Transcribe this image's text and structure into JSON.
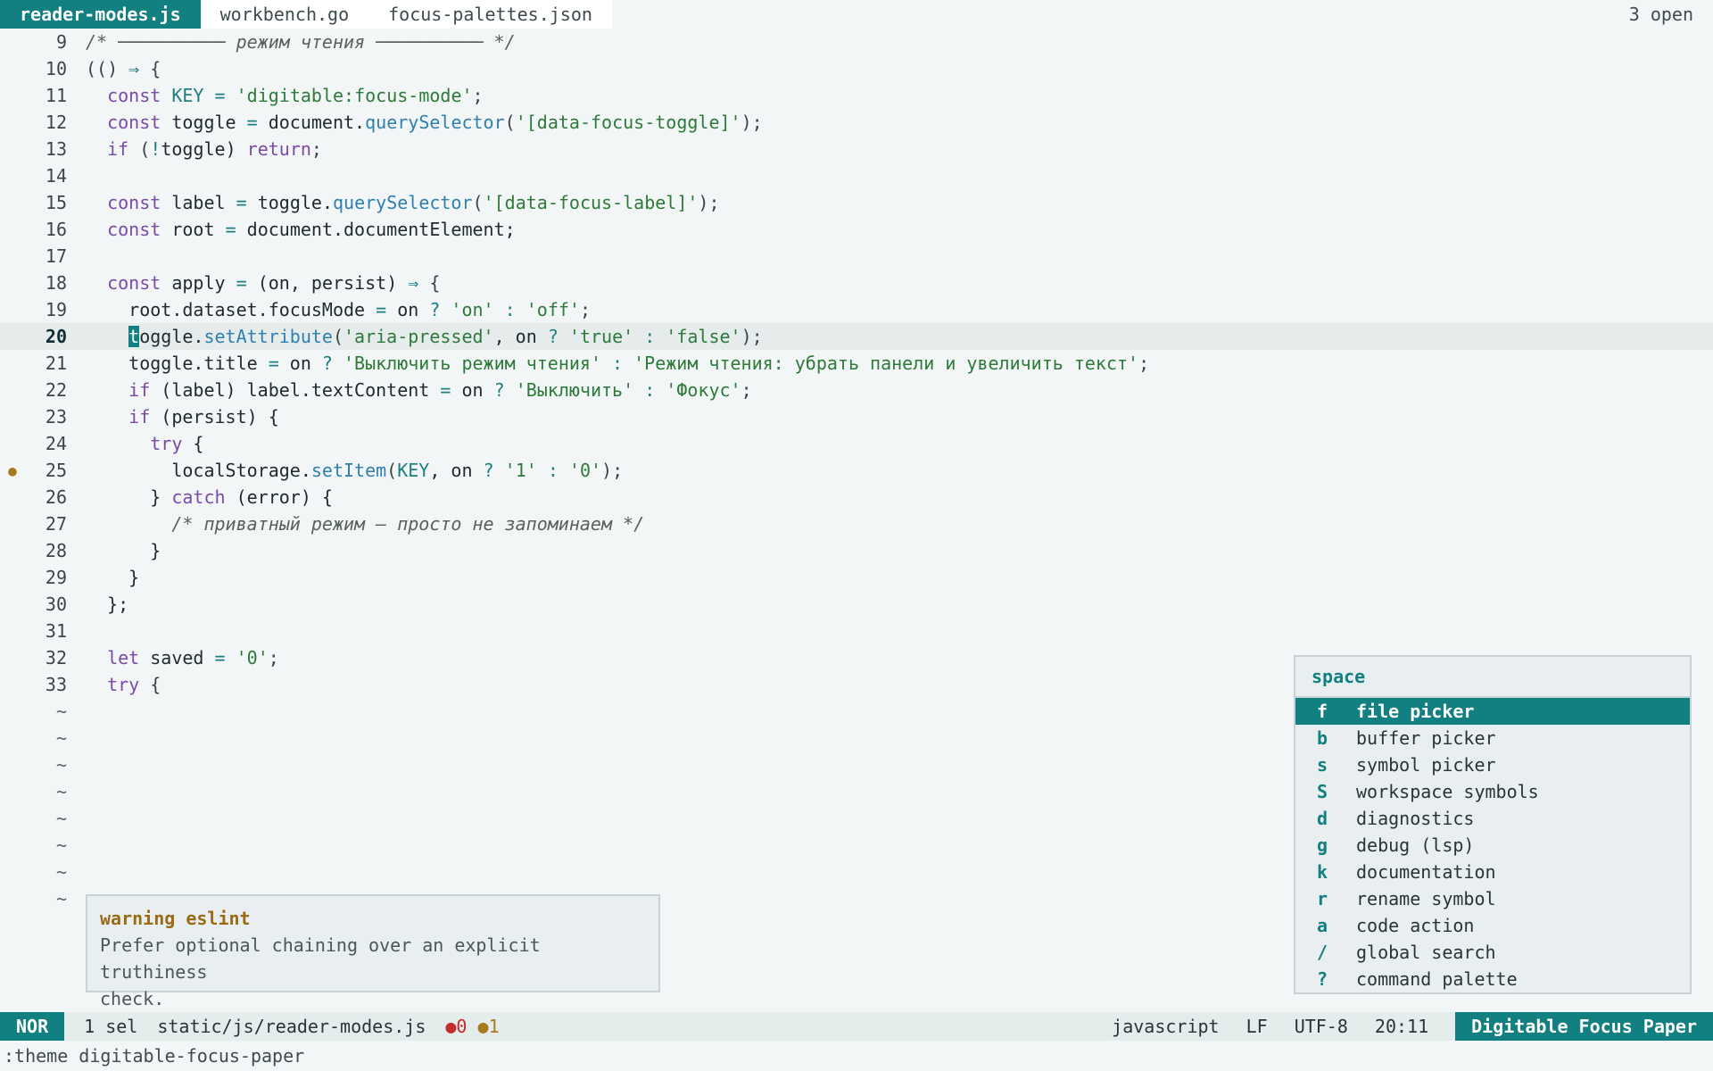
{
  "tabs": [
    {
      "label": "reader-modes.js",
      "active": true
    },
    {
      "label": "workbench.go",
      "active": false
    },
    {
      "label": "focus-palettes.json",
      "active": false
    }
  ],
  "open_count": "3 open",
  "lines": {
    "l9": {
      "num": "9"
    },
    "l10": {
      "num": "10"
    },
    "l11": {
      "num": "11"
    },
    "l12": {
      "num": "12"
    },
    "l13": {
      "num": "13"
    },
    "l14": {
      "num": "14"
    },
    "l15": {
      "num": "15"
    },
    "l16": {
      "num": "16"
    },
    "l17": {
      "num": "17"
    },
    "l18": {
      "num": "18"
    },
    "l19": {
      "num": "19"
    },
    "l20": {
      "num": "20"
    },
    "l21": {
      "num": "21"
    },
    "l22": {
      "num": "22"
    },
    "l23": {
      "num": "23"
    },
    "l24": {
      "num": "24"
    },
    "l25": {
      "num": "25",
      "gutter": "●"
    },
    "l26": {
      "num": "26"
    },
    "l27": {
      "num": "27"
    },
    "l28": {
      "num": "28"
    },
    "l29": {
      "num": "29"
    },
    "l30": {
      "num": "30"
    },
    "l31": {
      "num": "31"
    },
    "l32": {
      "num": "32"
    },
    "l33": {
      "num": "33"
    }
  },
  "code": {
    "t9": "/* ────────── режим чтения ────────── */",
    "t10": [
      "(() ",
      "⇒",
      " {"
    ],
    "t11": [
      "  ",
      "const",
      " KEY ",
      "=",
      " ",
      "'digitable:focus-mode'",
      ";"
    ],
    "t12": [
      "  ",
      "const",
      " toggle ",
      "=",
      " document.",
      "querySelector",
      "(",
      "'[data-focus-toggle]'",
      ");"
    ],
    "t13": [
      "  ",
      "if",
      " (",
      "!",
      "toggle) ",
      "return",
      ";"
    ],
    "t15": [
      "  ",
      "const",
      " label ",
      "=",
      " toggle.",
      "querySelector",
      "(",
      "'[data-focus-label]'",
      ");"
    ],
    "t16": [
      "  ",
      "const",
      " root ",
      "=",
      " document.documentElement;"
    ],
    "t18": [
      "  ",
      "const",
      " apply ",
      "=",
      " (on, persist) ",
      "⇒",
      " {"
    ],
    "t19": [
      "    root.dataset.focusMode ",
      "=",
      " on ",
      "?",
      " ",
      "'on'",
      " ",
      ":",
      " ",
      "'off'",
      ";"
    ],
    "t20": [
      "    ",
      "t",
      "oggle.",
      "setAttribute",
      "(",
      "'aria-pressed'",
      ", on ",
      "?",
      " ",
      "'true'",
      " ",
      ":",
      " ",
      "'false'",
      ");"
    ],
    "t21": [
      "    toggle.title ",
      "=",
      " on ",
      "?",
      " ",
      "'Выключить режим чтения'",
      " ",
      ":",
      " ",
      "'Режим чтения: убрать панели и увеличить текст'",
      ";"
    ],
    "t22": [
      "    ",
      "if",
      " (label) label.textContent ",
      "=",
      " on ",
      "?",
      " ",
      "'Выключить'",
      " ",
      ":",
      " ",
      "'Фокус'",
      ";"
    ],
    "t23": [
      "    ",
      "if",
      " (persist) {"
    ],
    "t24": [
      "      ",
      "try",
      " {"
    ],
    "t25": [
      "        localStorage.",
      "setItem",
      "(",
      "KEY",
      ", on ",
      "?",
      " ",
      "'1'",
      " ",
      ":",
      " ",
      "'0'",
      ");"
    ],
    "t26": [
      "      } ",
      "catch",
      " (error) {"
    ],
    "t27": [
      "        ",
      "/* приватный режим — просто не запоминаем */"
    ],
    "t28": "      }",
    "t29": "    }",
    "t30": "  };",
    "t32": [
      "  ",
      "let",
      " saved ",
      "=",
      " ",
      "'0'",
      ";"
    ],
    "t33": [
      "  ",
      "try",
      " {"
    ]
  },
  "tilde": "~",
  "diagnostic": {
    "title": "warning eslint",
    "line1": "Prefer optional chaining over an explicit truthiness",
    "line2": "check."
  },
  "menu": {
    "title": "space",
    "items": [
      {
        "key": "f",
        "label": "file picker"
      },
      {
        "key": "b",
        "label": "buffer picker"
      },
      {
        "key": "s",
        "label": "symbol picker"
      },
      {
        "key": "S",
        "label": "workspace symbols"
      },
      {
        "key": "d",
        "label": "diagnostics"
      },
      {
        "key": "g",
        "label": "debug (lsp)"
      },
      {
        "key": "k",
        "label": "documentation"
      },
      {
        "key": "r",
        "label": "rename symbol"
      },
      {
        "key": "a",
        "label": "code action"
      },
      {
        "key": "/",
        "label": "global search"
      },
      {
        "key": "?",
        "label": "command palette"
      }
    ]
  },
  "status": {
    "mode": "NOR",
    "selections": "1 sel",
    "path": "static/js/reader-modes.js",
    "error_dot": "●",
    "errors": "0",
    "warn_dot": "●",
    "warnings": "1",
    "language": "javascript",
    "line_ending": "LF",
    "encoding": "UTF-8",
    "position": "20:11",
    "theme": "Digitable Focus Paper"
  },
  "command_line": ":theme digitable-focus-paper",
  "colors": {
    "accent": "#127f80",
    "background": "#f3f6f6",
    "warning": "#a9791f",
    "error": "#c22c2c"
  }
}
